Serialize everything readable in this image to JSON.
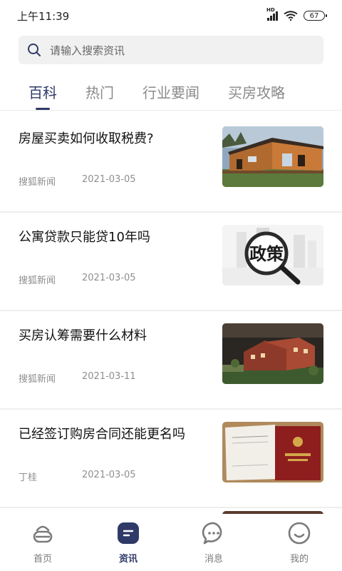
{
  "status_bar": {
    "time": "上午11:39",
    "network": "HD",
    "battery": "67"
  },
  "search": {
    "placeholder": "请输入搜索资讯"
  },
  "tabs": [
    {
      "label": "百科",
      "active": true
    },
    {
      "label": "热门",
      "active": false
    },
    {
      "label": "行业要闻",
      "active": false
    },
    {
      "label": "买房攻略",
      "active": false
    }
  ],
  "news": [
    {
      "title": "房屋买卖如何收取税费?",
      "source": "搜狐新闻",
      "date": "2021-03-05",
      "thumbnail": "wooden-house-photo"
    },
    {
      "title": "公寓贷款只能贷10年吗",
      "source": "搜狐新闻",
      "date": "2021-03-05",
      "thumbnail": "policy-magnifier-photo",
      "thumb_text": "政策"
    },
    {
      "title": "买房认筹需要什么材料",
      "source": "搜狐新闻",
      "date": "2021-03-11",
      "thumbnail": "building-model-photo"
    },
    {
      "title": "已经签订购房合同还能更名吗",
      "source": "丁桂",
      "date": "2021-03-05",
      "thumbnail": "property-certificate-photo"
    }
  ],
  "bottom_nav": [
    {
      "label": "首页",
      "icon": "home-icon",
      "active": false
    },
    {
      "label": "资讯",
      "icon": "news-icon",
      "active": true
    },
    {
      "label": "消息",
      "icon": "message-icon",
      "active": false
    },
    {
      "label": "我的",
      "icon": "profile-icon",
      "active": false
    }
  ],
  "colors": {
    "accent": "#2f3a68",
    "inactive_tab": "#8a8a8a",
    "meta_text": "#8e8e8e"
  }
}
